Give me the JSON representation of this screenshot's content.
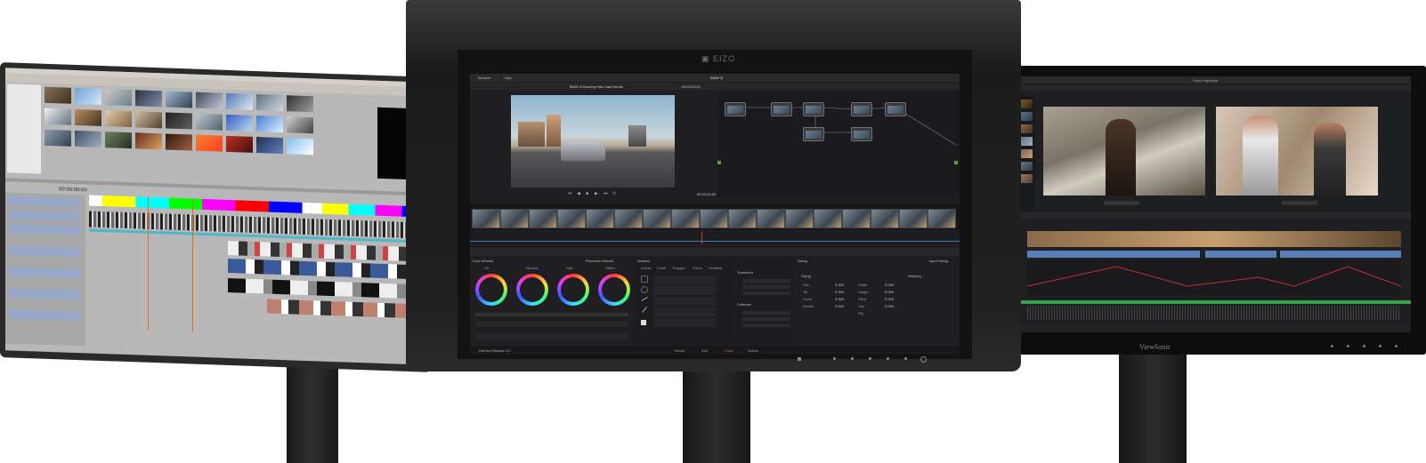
{
  "center": {
    "brand": "EIZO",
    "menu_left": "Timeline",
    "menu_clips": "Clips",
    "window_title": "BMW i3",
    "clip_name": "BMW i3 Burning Hills Gain Rental",
    "timecode_top": "00:00:29:21",
    "timecode_viewer": "00:01:21:20",
    "panel_color_wheels": "Color Wheels",
    "panel_primaries": "Primaries Wheels",
    "panel_window": "Window",
    "panel_sizing": "Sizing",
    "panel_input_sizing": "Input Sizing",
    "wheel_labels": [
      "Lift",
      "Gamma",
      "Gain",
      "Offset"
    ],
    "window_tools": [
      "Linear",
      "Circle",
      "Polygon",
      "Curve",
      "Gradient"
    ],
    "transform_label": "Transform",
    "softness_label": "Softness",
    "sizing_section": "Sizing",
    "warping_section": "Warping",
    "sizing_fields": [
      "Pan",
      "Tilt",
      "Zoom",
      "Rotate",
      "Width",
      "Height",
      "Pitch",
      "Yaw",
      "Flip"
    ],
    "field_value": "0.000",
    "app_name": "DaVinci Resolve 12",
    "bottom_tabs": [
      "Media",
      "Edit",
      "Color",
      "Deliver"
    ]
  },
  "right": {
    "brand": "ViewSonic",
    "project_name": "Sonic Highways"
  },
  "left": {
    "timecode": "00:00:00:00"
  },
  "colors": {
    "resolve_bg": "#1f1f21",
    "accent_orange": "#e07020",
    "track_green": "#3aa14a",
    "clip_blue": "#5a7fb8"
  }
}
